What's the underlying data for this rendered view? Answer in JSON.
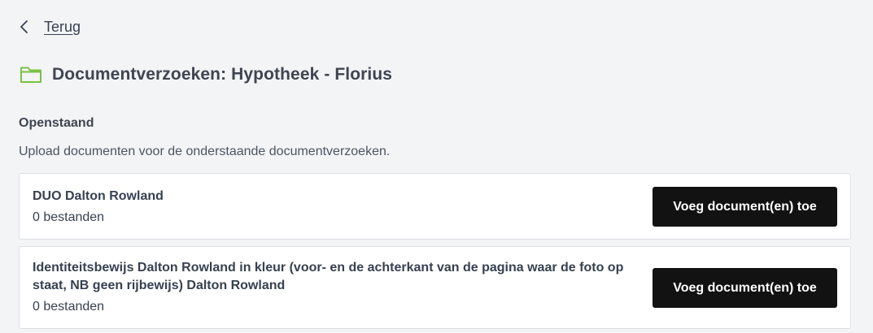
{
  "nav": {
    "back_label": "Terug",
    "back_icon": "chevron-left-icon"
  },
  "header": {
    "title": "Documentverzoeken: Hypotheek - Florius",
    "icon": "folder-icon",
    "icon_color": "#7ac143"
  },
  "section": {
    "title": "Openstaand",
    "description": "Upload documenten voor de onderstaande documentverzoeken."
  },
  "requests": [
    {
      "name": "DUO Dalton Rowland",
      "files": "0 bestanden",
      "button_label": "Voeg document(en) toe"
    },
    {
      "name": "Identiteitsbewijs Dalton Rowland in kleur (voor- en de achterkant van de pagina waar de foto op staat, NB geen rijbewijs) Dalton Rowland",
      "files": "0 bestanden",
      "button_label": "Voeg document(en) toe"
    }
  ]
}
